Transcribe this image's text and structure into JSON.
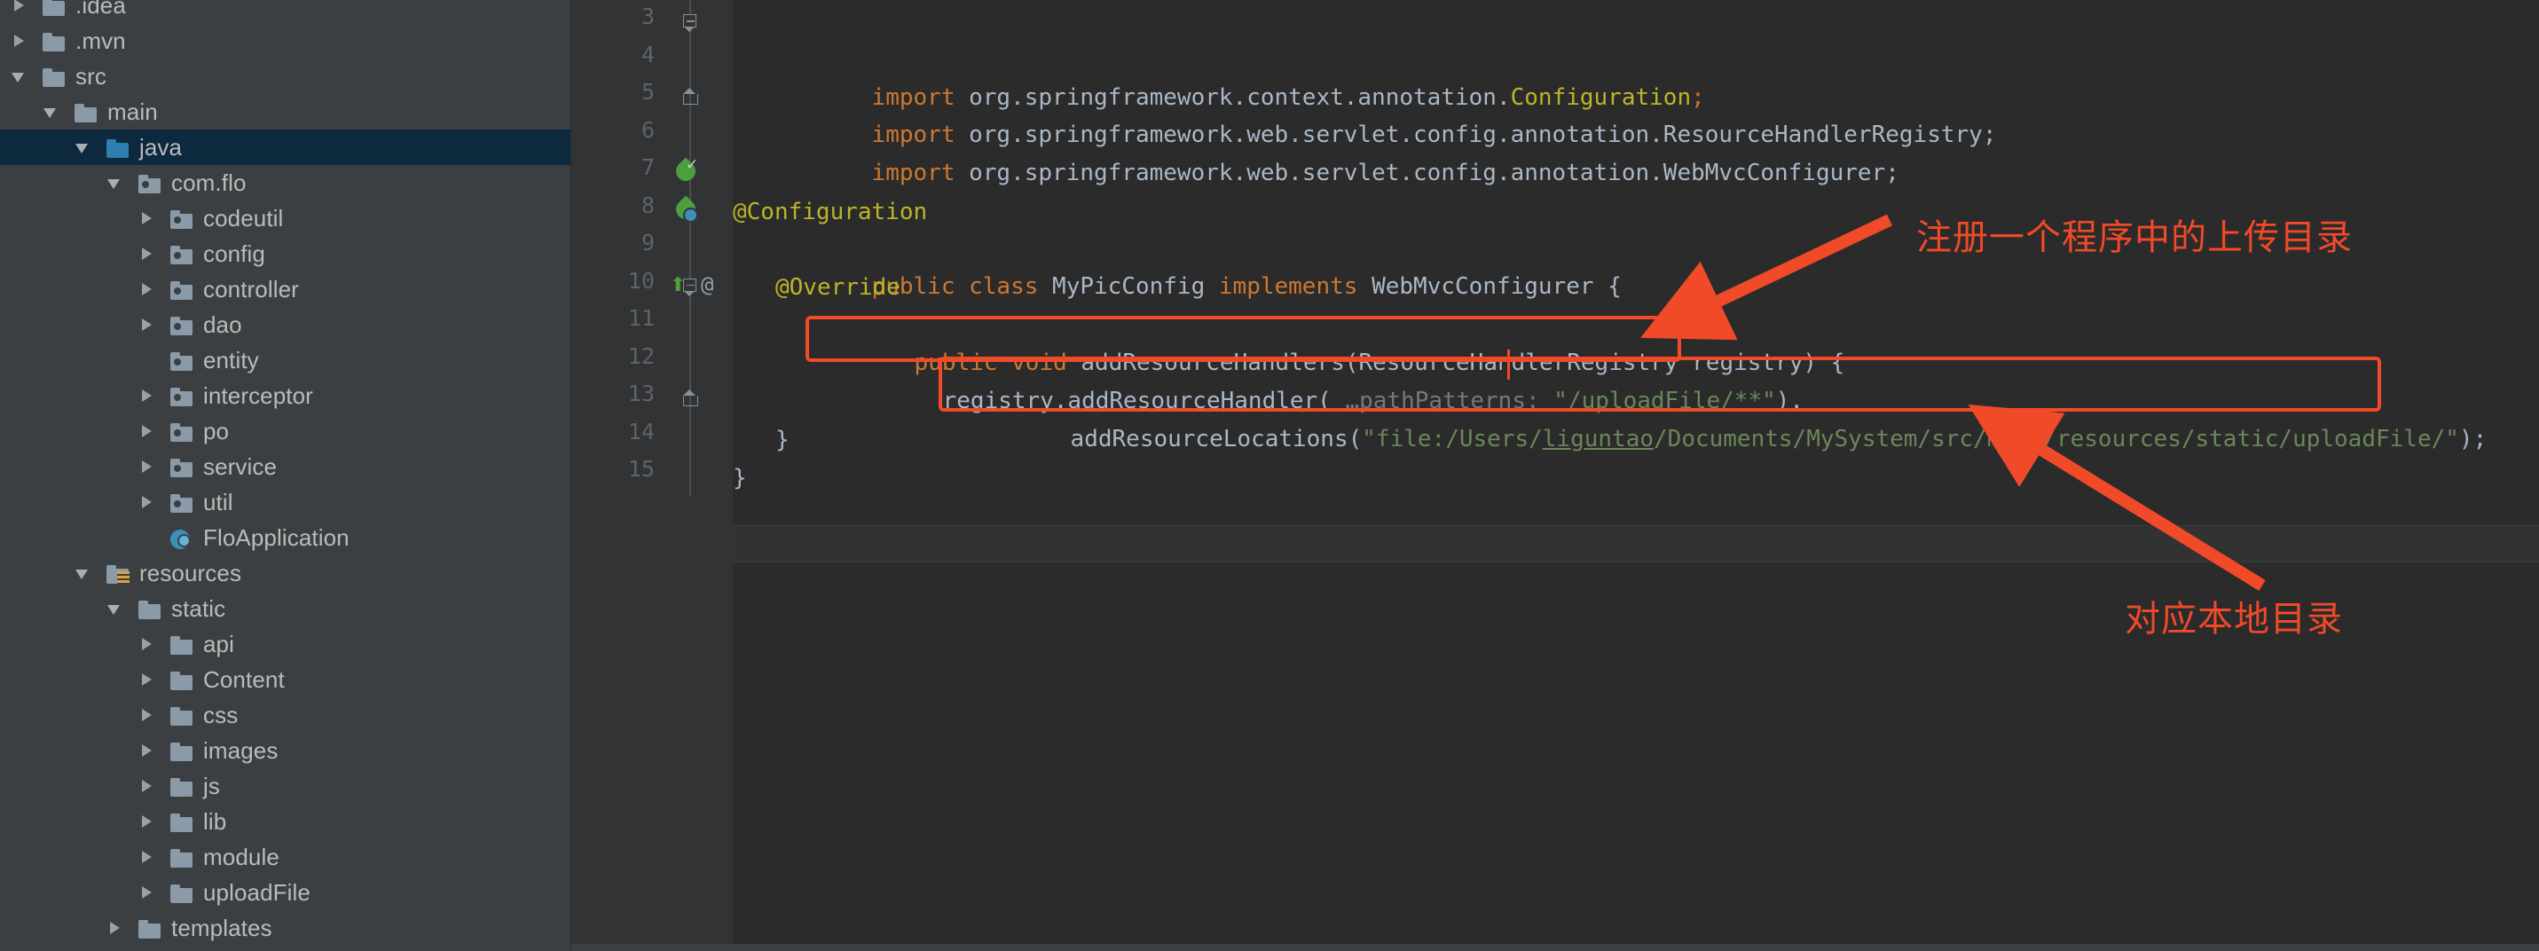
{
  "window": {
    "theme": "darcula",
    "accent_red": "#f04a28",
    "sidebar_bg": "#3c3f41",
    "editor_bg": "#2b2b2b",
    "selected_row_bg": "#0d293e"
  },
  "sidebar": {
    "name": "project-tree",
    "items": [
      {
        "label": ".idea",
        "indent": 0,
        "state": "collapsed",
        "icon": "folder",
        "selected": false
      },
      {
        "label": ".mvn",
        "indent": 0,
        "state": "collapsed",
        "icon": "folder",
        "selected": false
      },
      {
        "label": "src",
        "indent": 0,
        "state": "expanded",
        "icon": "folder",
        "selected": false
      },
      {
        "label": "main",
        "indent": 1,
        "state": "expanded",
        "icon": "folder",
        "selected": false
      },
      {
        "label": "java",
        "indent": 2,
        "state": "expanded",
        "icon": "folder-blue",
        "selected": true
      },
      {
        "label": "com.flo",
        "indent": 3,
        "state": "expanded",
        "icon": "package",
        "selected": false
      },
      {
        "label": "codeutil",
        "indent": 4,
        "state": "collapsed",
        "icon": "package",
        "selected": false
      },
      {
        "label": "config",
        "indent": 4,
        "state": "collapsed",
        "icon": "package",
        "selected": false
      },
      {
        "label": "controller",
        "indent": 4,
        "state": "collapsed",
        "icon": "package",
        "selected": false
      },
      {
        "label": "dao",
        "indent": 4,
        "state": "collapsed",
        "icon": "package",
        "selected": false
      },
      {
        "label": "entity",
        "indent": 4,
        "state": "leaf",
        "icon": "package",
        "selected": false
      },
      {
        "label": "interceptor",
        "indent": 4,
        "state": "collapsed",
        "icon": "package",
        "selected": false
      },
      {
        "label": "po",
        "indent": 4,
        "state": "collapsed",
        "icon": "package",
        "selected": false
      },
      {
        "label": "service",
        "indent": 4,
        "state": "collapsed",
        "icon": "package",
        "selected": false
      },
      {
        "label": "util",
        "indent": 4,
        "state": "collapsed",
        "icon": "package",
        "selected": false
      },
      {
        "label": "FloApplication",
        "indent": 4,
        "state": "leaf",
        "icon": "spring-class",
        "selected": false
      },
      {
        "label": "resources",
        "indent": 2,
        "state": "expanded",
        "icon": "resources-root",
        "selected": false
      },
      {
        "label": "static",
        "indent": 3,
        "state": "expanded",
        "icon": "folder",
        "selected": false
      },
      {
        "label": "api",
        "indent": 4,
        "state": "collapsed",
        "icon": "folder",
        "selected": false
      },
      {
        "label": "Content",
        "indent": 4,
        "state": "collapsed",
        "icon": "folder",
        "selected": false
      },
      {
        "label": "css",
        "indent": 4,
        "state": "collapsed",
        "icon": "folder",
        "selected": false
      },
      {
        "label": "images",
        "indent": 4,
        "state": "collapsed",
        "icon": "folder",
        "selected": false
      },
      {
        "label": "js",
        "indent": 4,
        "state": "collapsed",
        "icon": "folder",
        "selected": false
      },
      {
        "label": "lib",
        "indent": 4,
        "state": "collapsed",
        "icon": "folder",
        "selected": false
      },
      {
        "label": "module",
        "indent": 4,
        "state": "collapsed",
        "icon": "folder",
        "selected": false
      },
      {
        "label": "uploadFile",
        "indent": 4,
        "state": "collapsed",
        "icon": "folder",
        "selected": false
      },
      {
        "label": "templates",
        "indent": 3,
        "state": "collapsed",
        "icon": "folder",
        "selected": false
      }
    ]
  },
  "editor": {
    "name": "code-editor",
    "language": "java",
    "lines": [
      {
        "num": "3",
        "fold": "start",
        "gutter": null
      },
      {
        "num": "4",
        "fold": null,
        "gutter": null
      },
      {
        "num": "5",
        "fold": "end",
        "gutter": null
      },
      {
        "num": "6",
        "fold": null,
        "gutter": null
      },
      {
        "num": "7",
        "fold": null,
        "gutter": "spring-bean-check-icon"
      },
      {
        "num": "8",
        "fold": null,
        "gutter": "spring-bean-icon"
      },
      {
        "num": "9",
        "fold": null,
        "gutter": null
      },
      {
        "num": "10",
        "fold": "start",
        "gutter": "override-marker-icon"
      },
      {
        "num": "11",
        "fold": null,
        "gutter": null
      },
      {
        "num": "12",
        "fold": null,
        "gutter": null
      },
      {
        "num": "13",
        "fold": "end",
        "gutter": null
      },
      {
        "num": "14",
        "fold": null,
        "gutter": null
      },
      {
        "num": "15",
        "fold": null,
        "gutter": null
      }
    ],
    "code": {
      "l3_kw": "import",
      "l3_pkg": " org.springframework.context.annotation.",
      "l3_type": "Configuration",
      "l3_semi": ";",
      "l4_kw": "import",
      "l4_rest": " org.springframework.web.servlet.config.annotation.ResourceHandlerRegistry;",
      "l5_kw": "import",
      "l5_rest": " org.springframework.web.servlet.config.annotation.WebMvcConfigurer;",
      "l7_ann": "@Configuration",
      "l8_kw1": "public class",
      "l8_name": " MyPicConfig ",
      "l8_kw2": "implements",
      "l8_rest": " WebMvcConfigurer {",
      "l9_ann": "@Override",
      "l10_kw": "public void",
      "l10_rest": " addResourceHandlers(ResourceHandlerRegistry registry) {",
      "l11_a": "registry.addResourceHandler(",
      "l11_hint": " …pathPatterns: ",
      "l11_str": "\"/uploadFile/**\"",
      "l11_b": ").",
      "l12_a": "addResourceLocations(",
      "l12_str_pre": "\"file:/Users/",
      "l12_str_user": "liguntao",
      "l12_str_post": "/Documents/MySystem/src/main/resources/static/uploadFile/\"",
      "l12_b": ");",
      "l13": "}",
      "l14": "}"
    }
  },
  "annotations": {
    "name": "screenshot-annotations",
    "color": "#f04a28",
    "labels": [
      {
        "id": "upload-dir-note",
        "text": "注册一个程序中的上传目录"
      },
      {
        "id": "local-dir-note",
        "text": "对应本地目录"
      }
    ],
    "boxes": [
      {
        "id": "handler-pattern-box"
      },
      {
        "id": "resource-location-box"
      }
    ],
    "arrows": [
      {
        "id": "arrow-to-handler-line"
      },
      {
        "id": "arrow-to-location-line"
      }
    ]
  }
}
